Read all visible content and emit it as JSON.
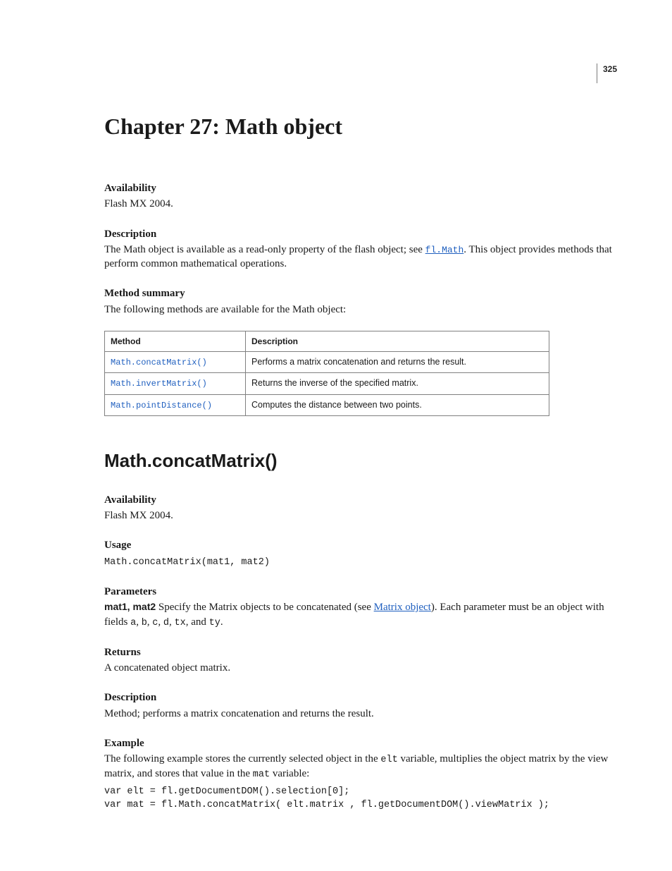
{
  "page_number": "325",
  "chapter_title": "Chapter 27: Math object",
  "intro": {
    "availability_h": "Availability",
    "availability_t": "Flash MX 2004.",
    "description_h": "Description",
    "description_t1": "The Math object is available as a read-only property of the flash object; see ",
    "description_link": "fl.Math",
    "description_t2": ". This object provides methods that perform common mathematical operations.",
    "summary_h": "Method summary",
    "summary_t": "The following methods are available for the Math object:",
    "table": {
      "header_method": "Method",
      "header_desc": "Description",
      "rows": [
        {
          "method": "Math.concatMatrix()",
          "desc": "Performs a matrix concatenation and returns the result."
        },
        {
          "method": "Math.invertMatrix()",
          "desc": "Returns the inverse of the specified matrix."
        },
        {
          "method": "Math.pointDistance()",
          "desc": "Computes the distance between two points."
        }
      ]
    }
  },
  "section": {
    "title": "Math.concatMatrix()",
    "availability_h": "Availability",
    "availability_t": "Flash MX 2004.",
    "usage_h": "Usage",
    "usage_code": "Math.concatMatrix(mat1, mat2)",
    "parameters_h": "Parameters",
    "param_name": "mat1, mat2",
    "param_t1": "  Specify the Matrix objects to be concatenated (see ",
    "param_link": "Matrix object",
    "param_t2": "). Each parameter must be an object with fields ",
    "param_f1": "a",
    "param_c1": ", ",
    "param_f2": "b",
    "param_c2": ", ",
    "param_f3": "c",
    "param_c3": ", ",
    "param_f4": "d",
    "param_c4": ", ",
    "param_f5": "tx",
    "param_c5": ", and ",
    "param_f6": "ty",
    "param_c6": ".",
    "returns_h": "Returns",
    "returns_t": "A concatenated object matrix.",
    "description_h": "Description",
    "description_t": "Method; performs a matrix concatenation and returns the result.",
    "example_h": "Example",
    "example_t1": "The following example stores the currently selected object in the ",
    "example_v1": "elt",
    "example_t2": " variable, multiplies the object matrix by the view matrix, and stores that value in the ",
    "example_v2": "mat",
    "example_t3": " variable:",
    "example_code": "var elt = fl.getDocumentDOM().selection[0];\nvar mat = fl.Math.concatMatrix( elt.matrix , fl.getDocumentDOM().viewMatrix );"
  }
}
